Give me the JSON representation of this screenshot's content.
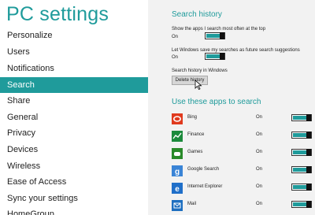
{
  "sidebar": {
    "title": "PC settings",
    "items": [
      {
        "label": "Personalize"
      },
      {
        "label": "Users"
      },
      {
        "label": "Notifications"
      },
      {
        "label": "Search"
      },
      {
        "label": "Share"
      },
      {
        "label": "General"
      },
      {
        "label": "Privacy"
      },
      {
        "label": "Devices"
      },
      {
        "label": "Wireless"
      },
      {
        "label": "Ease of Access"
      },
      {
        "label": "Sync your settings"
      },
      {
        "label": "HomeGroup"
      }
    ],
    "selected": "Search"
  },
  "search_history": {
    "heading": "Search history",
    "setting1": {
      "label": "Show the apps I search most often at the top",
      "state": "On"
    },
    "setting2": {
      "label": "Let Windows save my searches as future search suggestions",
      "state": "On"
    },
    "history_label": "Search history in Windows",
    "delete_button": "Delete history"
  },
  "apps": {
    "heading": "Use these apps to search",
    "items": [
      {
        "name": "Bing",
        "state": "On",
        "icon": "bing-icon",
        "color": "#e03a1e"
      },
      {
        "name": "Finance",
        "state": "On",
        "icon": "finance-icon",
        "color": "#1c8a3c"
      },
      {
        "name": "Games",
        "state": "On",
        "icon": "games-icon",
        "color": "#2a8a2a"
      },
      {
        "name": "Google Search",
        "state": "On",
        "icon": "google-search-icon",
        "color": "#3a84d6"
      },
      {
        "name": "Internet Explorer",
        "state": "On",
        "icon": "internet-explorer-icon",
        "color": "#1f6fc9"
      },
      {
        "name": "Mail",
        "state": "On",
        "icon": "mail-icon",
        "color": "#1e6fc0"
      }
    ]
  },
  "colors": {
    "accent": "#1f9b9b",
    "panel": "#f2f2f2"
  }
}
